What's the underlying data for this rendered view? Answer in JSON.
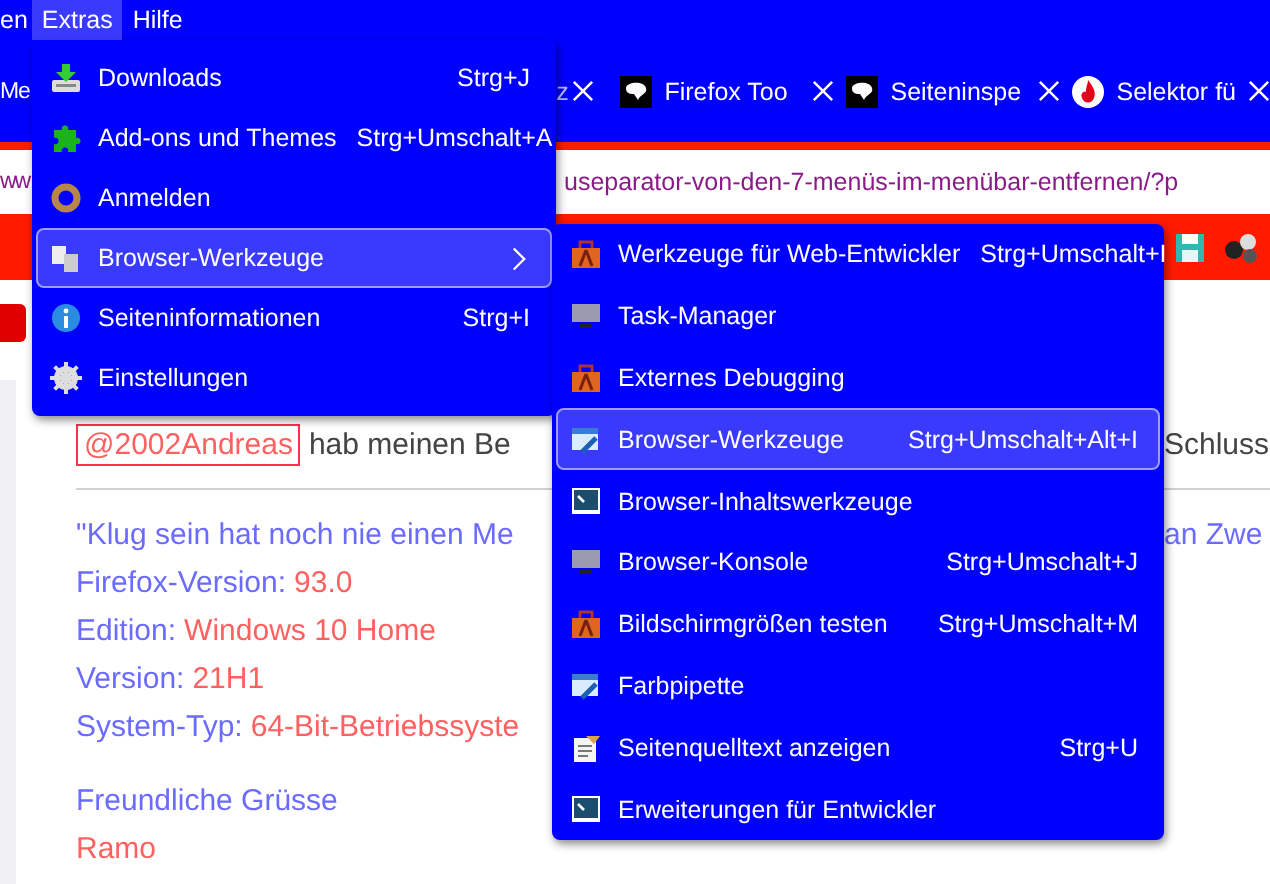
{
  "menubar": [
    {
      "label": "en",
      "selected": false
    },
    {
      "label": "Extras",
      "selected": true
    },
    {
      "label": "Hilfe",
      "selected": false
    }
  ],
  "tabs": [
    {
      "title": "Me"
    },
    {
      "title": "z"
    },
    {
      "title": "Firefox Too"
    },
    {
      "title": "Seiteninspe"
    },
    {
      "title": "Selektor fü"
    }
  ],
  "url_parts": [
    "ww",
    "useparator-von-den-7-menüs-im-menübar-entfernen/?p"
  ],
  "page": {
    "mention": "@2002Andreas",
    "intro": "hab meinen Be",
    "intro_right": "Schluss",
    "lines": [
      {
        "label": "\"Klug sein hat noch nie einen Me",
        "right": "an Zwe"
      },
      {
        "label": "Firefox-Version: ",
        "value": "93.0"
      },
      {
        "label": "Edition: ",
        "value": "Windows 10 Home"
      },
      {
        "label": "Version: ",
        "value": "21H1"
      },
      {
        "label": "System-Typ: ",
        "value": "64-Bit-Betriebssyste"
      }
    ],
    "greeting": "Freundliche Grüsse",
    "signature": "Ramo"
  },
  "extras_menu": [
    {
      "label": "Downloads",
      "shortcut": "Strg+J",
      "selected": false
    },
    {
      "label": "Add-ons und Themes",
      "shortcut": "Strg+Umschalt+A",
      "selected": false
    },
    {
      "label": "Anmelden",
      "selected": false
    },
    {
      "label": "Browser-Werkzeuge",
      "selected": true
    },
    {
      "label": "Seiteninformationen",
      "shortcut": "Strg+I",
      "selected": false
    },
    {
      "label": "Einstellungen",
      "selected": false
    }
  ],
  "tools_menu": [
    {
      "label": "Werkzeuge für Web-Entwickler",
      "shortcut": "Strg+Umschalt+I",
      "selected": false
    },
    {
      "label": "Task-Manager",
      "selected": false
    },
    {
      "label": "Externes Debugging",
      "selected": false
    },
    {
      "label": "Browser-Werkzeuge",
      "shortcut": "Strg+Umschalt+Alt+I",
      "selected": true
    },
    {
      "label": "Browser-Inhaltswerkzeuge",
      "selected": false
    },
    {
      "label": "Browser-Konsole",
      "shortcut": "Strg+Umschalt+J",
      "selected": false
    },
    {
      "label": "Bildschirmgrößen testen",
      "shortcut": "Strg+Umschalt+M",
      "selected": false
    },
    {
      "label": "Farbpipette",
      "selected": false
    },
    {
      "label": "Seitenquelltext anzeigen",
      "shortcut": "Strg+U",
      "selected": false
    },
    {
      "label": "Erweiterungen für Entwickler",
      "selected": false
    }
  ]
}
